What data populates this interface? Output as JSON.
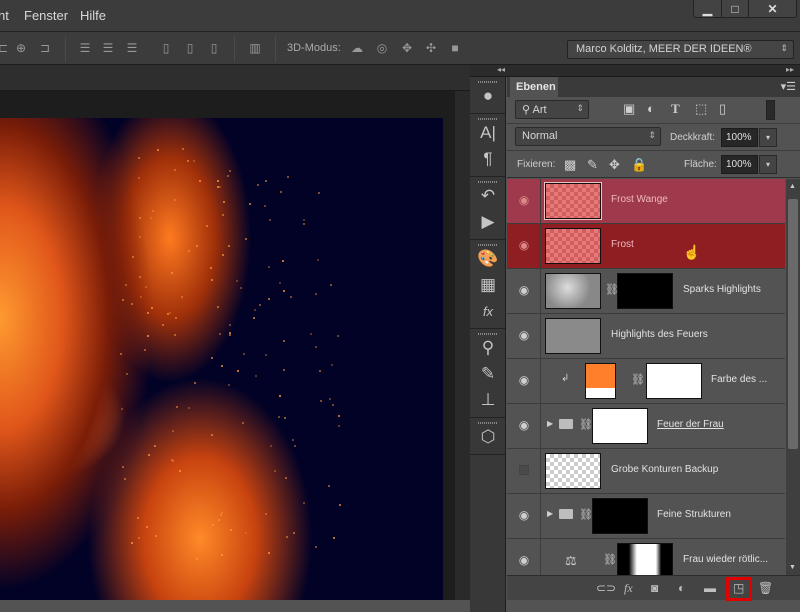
{
  "menubar": {
    "items": [
      "nt",
      "Fenster",
      "Hilfe"
    ]
  },
  "window_controls": {
    "minimize": "▁",
    "maximize": "□",
    "close": "✕"
  },
  "optionsbar": {
    "mode_label": "3D-Modus:",
    "align_icons": [
      "align-bottom-icon",
      "align-hcenter-icon",
      "align-right-icon",
      "distribute-top-icon",
      "distribute-vcenter-icon",
      "distribute-bottom-icon",
      "distribute-left-icon",
      "distribute-hcenter-icon",
      "distribute-right-icon",
      "auto-align-icon"
    ],
    "three_d_icons": [
      "rotate-3d-icon",
      "roll-3d-icon",
      "drag-3d-icon",
      "slide-3d-icon",
      "scale-3d-icon"
    ],
    "workspace": "Marco Kolditz, MEER DER IDEEN®"
  },
  "dock": {
    "groups": [
      [
        "info-icon"
      ],
      [
        "character-icon",
        "paragraph-icon"
      ],
      [
        "history-icon",
        "actions-icon"
      ],
      [
        "swatches-icon",
        "swatch-grid-icon",
        "styles-icon"
      ],
      [
        "brush-presets-icon",
        "brushes-icon",
        "clone-source-icon"
      ],
      [
        "3d-icon"
      ]
    ]
  },
  "layers_panel": {
    "tab": "Ebenen",
    "filter_kind": "Art",
    "filter_icons": [
      "pixel-filter-icon",
      "adjustment-filter-icon",
      "type-filter-icon",
      "shape-filter-icon",
      "smart-object-filter-icon"
    ],
    "blend_mode": "Normal",
    "opacity_label": "Deckkraft:",
    "opacity": "100%",
    "lock_label": "Fixieren:",
    "lock_icons": [
      "lock-transparency-icon",
      "lock-pixels-icon",
      "lock-position-icon",
      "lock-all-icon"
    ],
    "fill_label": "Fläche:",
    "fill": "100%",
    "layers": [
      {
        "name": "Frost Wange",
        "visible": true,
        "state": "selected-active"
      },
      {
        "name": "Frost",
        "visible": true,
        "state": "selected"
      },
      {
        "name": "Sparks Highlights",
        "visible": true,
        "state": "normal"
      },
      {
        "name": "Highlights des Feuers",
        "visible": true,
        "state": "normal"
      },
      {
        "name": "Farbe des ...",
        "visible": true,
        "state": "normal"
      },
      {
        "name": "Feuer der Frau",
        "visible": true,
        "state": "normal"
      },
      {
        "name": "Grobe Konturen Backup",
        "visible": false,
        "state": "normal"
      },
      {
        "name": "Feine Strukturen",
        "visible": true,
        "state": "normal"
      },
      {
        "name": "Frau wieder rötlic...",
        "visible": true,
        "state": "normal"
      }
    ],
    "bottom_icons": [
      "link-layers-icon",
      "fx-icon",
      "add-mask-icon",
      "adjustment-layer-icon",
      "new-group-icon",
      "new-layer-icon",
      "delete-layer-icon"
    ],
    "highlighted_button": "new-layer-icon"
  },
  "colors": {
    "selected_active": "#9e3a4b",
    "selected": "#8e1e22",
    "highlight_box": "#e00000",
    "color_fill": "#ff7f2a"
  }
}
